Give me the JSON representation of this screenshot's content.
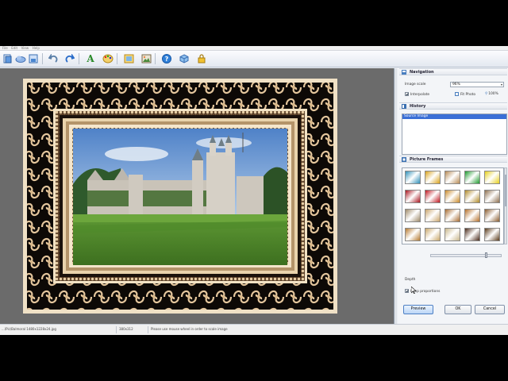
{
  "menubar": {
    "items": [
      "File",
      "Edit",
      "View",
      "Help"
    ]
  },
  "toolbar": {
    "buttons": [
      {
        "name": "open-icon"
      },
      {
        "name": "cloud-icon"
      },
      {
        "name": "save-icon"
      },
      {
        "name": "undo-icon"
      },
      {
        "name": "redo-icon"
      },
      {
        "name": "text-icon",
        "glyph": "A"
      },
      {
        "name": "palette-icon"
      },
      {
        "name": "image-frame-icon"
      },
      {
        "name": "picture-icon"
      },
      {
        "name": "help-icon",
        "glyph": "?"
      },
      {
        "name": "cube-icon"
      },
      {
        "name": "lock-icon"
      }
    ]
  },
  "panel": {
    "navigation": {
      "title": "Navigation",
      "scale_label": "Image scale",
      "scale_value": "96%",
      "interpolate_label": "Interpolate",
      "interpolate_checked": true,
      "fit_photo_label": "Fit Photo",
      "actual_label": "100%"
    },
    "history": {
      "title": "History",
      "items": [
        "Source Image"
      ]
    },
    "frames": {
      "title": "Picture Frames",
      "thumb_colors": [
        "#2f8fb8",
        "#d9a21b",
        "#b78a55",
        "#1f9a2f",
        "#e6cf1c",
        "#a8151f",
        "#c01821",
        "#c98a2a",
        "#b08a2a",
        "#8d6f4f",
        "#9f8a6a",
        "#c9a46b",
        "#a86c32",
        "#b5702a",
        "#8a5d2f",
        "#b57a2f",
        "#c9a76a",
        "#c8b68a",
        "#4a2a1a",
        "#5a3a1a"
      ],
      "depth_label": "Depth",
      "depth_value": 0.8,
      "keep_proportions_label": "Keep proportions",
      "keep_proportions_checked": true
    },
    "buttons": {
      "preview": "Preview",
      "ok": "OK",
      "cancel": "Cancel"
    }
  },
  "status": {
    "file": "...\\Pic\\Balmoral 1480x1228x24.jpg",
    "dims": "380x312",
    "hint": "Please use mouse wheel in order to scale image"
  },
  "colors": {
    "selection": "#3a6fd6",
    "canvas_bg": "#6b6b6b",
    "frame_cream": "#f0e1c6"
  }
}
